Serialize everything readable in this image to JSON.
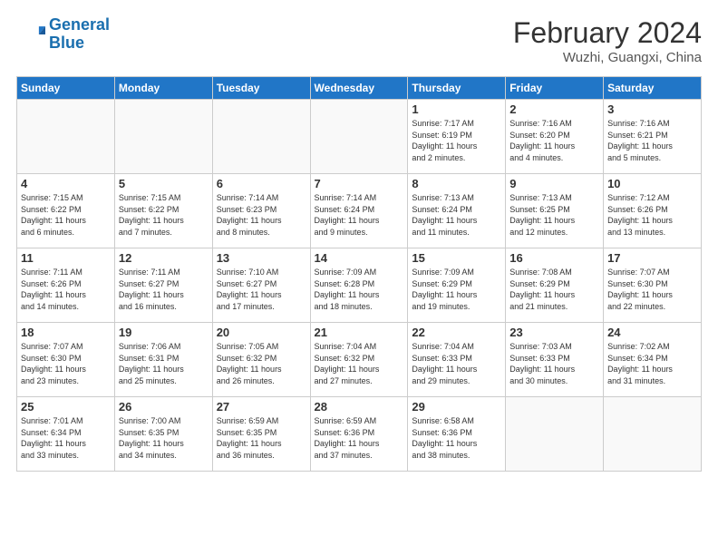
{
  "header": {
    "logo_line1": "General",
    "logo_line2": "Blue",
    "month_year": "February 2024",
    "location": "Wuzhi, Guangxi, China"
  },
  "weekdays": [
    "Sunday",
    "Monday",
    "Tuesday",
    "Wednesday",
    "Thursday",
    "Friday",
    "Saturday"
  ],
  "weeks": [
    [
      {
        "day": "",
        "info": ""
      },
      {
        "day": "",
        "info": ""
      },
      {
        "day": "",
        "info": ""
      },
      {
        "day": "",
        "info": ""
      },
      {
        "day": "1",
        "info": "Sunrise: 7:17 AM\nSunset: 6:19 PM\nDaylight: 11 hours\nand 2 minutes."
      },
      {
        "day": "2",
        "info": "Sunrise: 7:16 AM\nSunset: 6:20 PM\nDaylight: 11 hours\nand 4 minutes."
      },
      {
        "day": "3",
        "info": "Sunrise: 7:16 AM\nSunset: 6:21 PM\nDaylight: 11 hours\nand 5 minutes."
      }
    ],
    [
      {
        "day": "4",
        "info": "Sunrise: 7:15 AM\nSunset: 6:22 PM\nDaylight: 11 hours\nand 6 minutes."
      },
      {
        "day": "5",
        "info": "Sunrise: 7:15 AM\nSunset: 6:22 PM\nDaylight: 11 hours\nand 7 minutes."
      },
      {
        "day": "6",
        "info": "Sunrise: 7:14 AM\nSunset: 6:23 PM\nDaylight: 11 hours\nand 8 minutes."
      },
      {
        "day": "7",
        "info": "Sunrise: 7:14 AM\nSunset: 6:24 PM\nDaylight: 11 hours\nand 9 minutes."
      },
      {
        "day": "8",
        "info": "Sunrise: 7:13 AM\nSunset: 6:24 PM\nDaylight: 11 hours\nand 11 minutes."
      },
      {
        "day": "9",
        "info": "Sunrise: 7:13 AM\nSunset: 6:25 PM\nDaylight: 11 hours\nand 12 minutes."
      },
      {
        "day": "10",
        "info": "Sunrise: 7:12 AM\nSunset: 6:26 PM\nDaylight: 11 hours\nand 13 minutes."
      }
    ],
    [
      {
        "day": "11",
        "info": "Sunrise: 7:11 AM\nSunset: 6:26 PM\nDaylight: 11 hours\nand 14 minutes."
      },
      {
        "day": "12",
        "info": "Sunrise: 7:11 AM\nSunset: 6:27 PM\nDaylight: 11 hours\nand 16 minutes."
      },
      {
        "day": "13",
        "info": "Sunrise: 7:10 AM\nSunset: 6:27 PM\nDaylight: 11 hours\nand 17 minutes."
      },
      {
        "day": "14",
        "info": "Sunrise: 7:09 AM\nSunset: 6:28 PM\nDaylight: 11 hours\nand 18 minutes."
      },
      {
        "day": "15",
        "info": "Sunrise: 7:09 AM\nSunset: 6:29 PM\nDaylight: 11 hours\nand 19 minutes."
      },
      {
        "day": "16",
        "info": "Sunrise: 7:08 AM\nSunset: 6:29 PM\nDaylight: 11 hours\nand 21 minutes."
      },
      {
        "day": "17",
        "info": "Sunrise: 7:07 AM\nSunset: 6:30 PM\nDaylight: 11 hours\nand 22 minutes."
      }
    ],
    [
      {
        "day": "18",
        "info": "Sunrise: 7:07 AM\nSunset: 6:30 PM\nDaylight: 11 hours\nand 23 minutes."
      },
      {
        "day": "19",
        "info": "Sunrise: 7:06 AM\nSunset: 6:31 PM\nDaylight: 11 hours\nand 25 minutes."
      },
      {
        "day": "20",
        "info": "Sunrise: 7:05 AM\nSunset: 6:32 PM\nDaylight: 11 hours\nand 26 minutes."
      },
      {
        "day": "21",
        "info": "Sunrise: 7:04 AM\nSunset: 6:32 PM\nDaylight: 11 hours\nand 27 minutes."
      },
      {
        "day": "22",
        "info": "Sunrise: 7:04 AM\nSunset: 6:33 PM\nDaylight: 11 hours\nand 29 minutes."
      },
      {
        "day": "23",
        "info": "Sunrise: 7:03 AM\nSunset: 6:33 PM\nDaylight: 11 hours\nand 30 minutes."
      },
      {
        "day": "24",
        "info": "Sunrise: 7:02 AM\nSunset: 6:34 PM\nDaylight: 11 hours\nand 31 minutes."
      }
    ],
    [
      {
        "day": "25",
        "info": "Sunrise: 7:01 AM\nSunset: 6:34 PM\nDaylight: 11 hours\nand 33 minutes."
      },
      {
        "day": "26",
        "info": "Sunrise: 7:00 AM\nSunset: 6:35 PM\nDaylight: 11 hours\nand 34 minutes."
      },
      {
        "day": "27",
        "info": "Sunrise: 6:59 AM\nSunset: 6:35 PM\nDaylight: 11 hours\nand 36 minutes."
      },
      {
        "day": "28",
        "info": "Sunrise: 6:59 AM\nSunset: 6:36 PM\nDaylight: 11 hours\nand 37 minutes."
      },
      {
        "day": "29",
        "info": "Sunrise: 6:58 AM\nSunset: 6:36 PM\nDaylight: 11 hours\nand 38 minutes."
      },
      {
        "day": "",
        "info": ""
      },
      {
        "day": "",
        "info": ""
      }
    ]
  ]
}
